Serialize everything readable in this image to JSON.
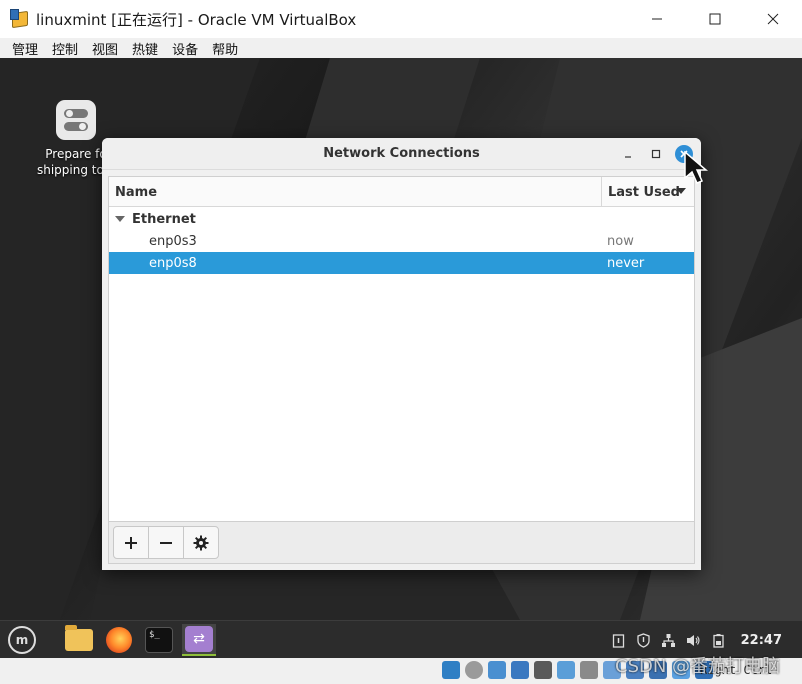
{
  "vbox_window": {
    "title": "linuxmint [正在运行] - Oracle VM VirtualBox",
    "menu": [
      "管理",
      "控制",
      "视图",
      "热键",
      "设备",
      "帮助"
    ],
    "host_key_label": "Right Ctrl"
  },
  "desktop": {
    "icon_label": "Prepare fo\nshipping to e"
  },
  "network_window": {
    "title": "Network Connections",
    "columns": {
      "name": "Name",
      "last_used": "Last Used"
    },
    "group": "Ethernet",
    "connections": [
      {
        "name": "enp0s3",
        "last_used": "now",
        "selected": false
      },
      {
        "name": "enp0s8",
        "last_used": "never",
        "selected": true
      }
    ],
    "toolbar": {
      "add": "+",
      "remove": "−"
    }
  },
  "panel": {
    "clock": "22:47"
  },
  "watermark": "CSDN @番茄打电脑",
  "colors": {
    "selection": "#2a9ad9",
    "panel_bg": "#2c2c2c",
    "accent_green": "#8fbf3a"
  }
}
